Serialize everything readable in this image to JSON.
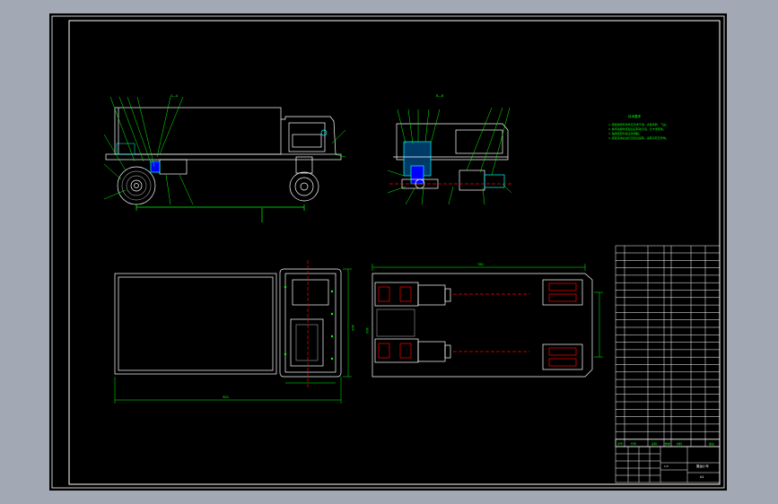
{
  "drawing": {
    "background_color": "#a2a8b4",
    "paper_color": "#000000",
    "line_color": "#ffffff",
    "dimension_color": "#00ff00",
    "hatch_color": "#00ffff",
    "centerline_color": "#ff0000"
  },
  "views": {
    "front": {
      "top_label": "A—A"
    },
    "section": {
      "top_label": "B—B"
    },
    "top": {
      "width_dim": "900",
      "height_dim": "300"
    },
    "bottom": {
      "width_dim": "780",
      "height_dim": "300"
    }
  },
  "notes": {
    "heading": "技术要求",
    "lines": [
      "1. 装配前所有零件应清洗干净，去除毛刺、飞边。",
      "2. 各传动部件装配后应转动灵活，无卡滞现象。",
      "3. 轴承装配时加注润滑脂。",
      "4. 装配完成后进行空载试运转，运转平稳无异响。"
    ]
  },
  "title_block": {
    "headers": [
      "序号",
      "代号",
      "名称",
      "数量",
      "材料",
      "备注"
    ],
    "drawing_name": "搬运小车",
    "scale": "1:5",
    "sheet": "A1"
  }
}
